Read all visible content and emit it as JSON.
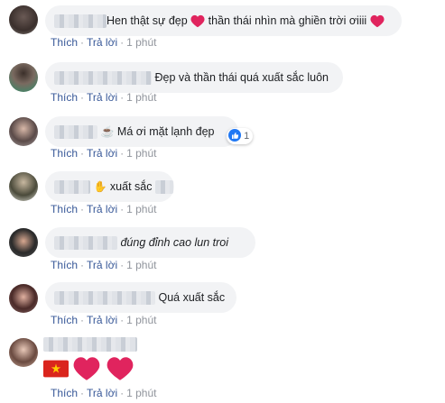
{
  "actions": {
    "like": "Thích",
    "reply": "Trả lời",
    "time": "1 phút",
    "separator": "·"
  },
  "comments": [
    {
      "text": "Hen thật sự đẹp",
      "text2": "thần thái nhìn mà ghiền trời ơiiii"
    },
    {
      "text": "Đẹp và thần thái quá xuất sắc luôn"
    },
    {
      "text": "Má ơi mặt lạnh đẹp",
      "reactions": "1"
    },
    {
      "text": "xuất sắc"
    },
    {
      "text": "đúng đỉnh cao lun troi"
    },
    {
      "text": "Quá xuất sắc"
    },
    {
      "text": ""
    }
  ],
  "colors": {
    "heart": "#e0245e",
    "link": "#385898",
    "bubble": "#f2f3f5",
    "like": "#2078f4",
    "flag_red": "#da251d",
    "flag_star": "#ffcd00"
  },
  "icons": [
    "heart-icon",
    "coffee-icon",
    "raised-hand-icon",
    "like-icon",
    "vietnam-flag-icon"
  ]
}
